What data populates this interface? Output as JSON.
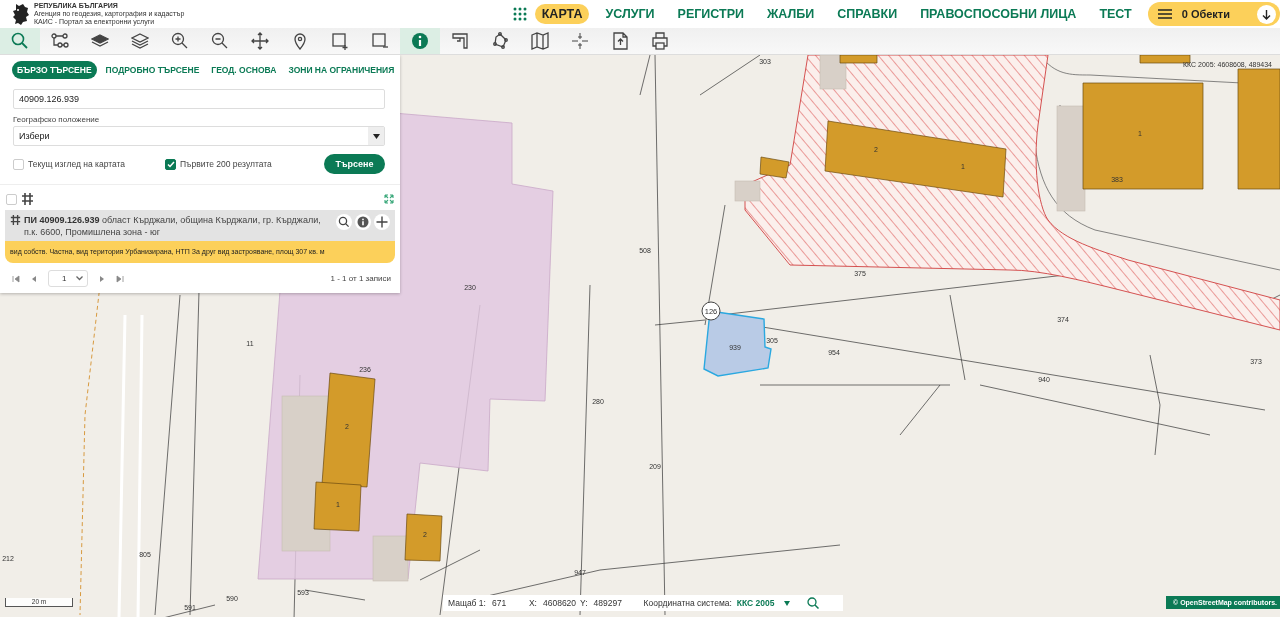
{
  "header": {
    "logo_lines": [
      "РЕПУБЛИКА БЪЛГАРИЯ",
      "Агенция по геодезия, картография и кадастър",
      "КАИС - Портал за електронни услуги"
    ],
    "nav": [
      {
        "label": "КАРТА",
        "selected": true
      },
      {
        "label": "УСЛУГИ",
        "selected": false
      },
      {
        "label": "РЕГИСТРИ",
        "selected": false
      },
      {
        "label": "ЖАЛБИ",
        "selected": false
      },
      {
        "label": "СПРАВКИ",
        "selected": false
      },
      {
        "label": "ПРАВОСПОСОБНИ ЛИЦА",
        "selected": false
      },
      {
        "label": "ТЕСТ",
        "selected": false
      }
    ],
    "cart": "0 Обекти"
  },
  "toolbar": [
    {
      "kind": "search",
      "selected": true
    },
    {
      "kind": "nodes",
      "selected": false
    },
    {
      "kind": "layer",
      "selected": false
    },
    {
      "kind": "layers",
      "selected": false
    },
    {
      "kind": "zoom-in",
      "selected": false
    },
    {
      "kind": "zoom-out",
      "selected": false
    },
    {
      "kind": "pan",
      "selected": false
    },
    {
      "kind": "pin",
      "selected": false
    },
    {
      "kind": "rect-plus",
      "selected": false
    },
    {
      "kind": "rect-minus",
      "selected": false
    },
    {
      "kind": "info",
      "selected": true
    },
    {
      "kind": "corner",
      "selected": false
    },
    {
      "kind": "polygon",
      "selected": false
    },
    {
      "kind": "map",
      "selected": false
    },
    {
      "kind": "crosshair",
      "selected": false
    },
    {
      "kind": "doc",
      "selected": false
    },
    {
      "kind": "print",
      "selected": false
    }
  ],
  "search_panel": {
    "tabs": [
      {
        "label": "БЪРЗО ТЪРСЕНЕ",
        "selected": true
      },
      {
        "label": "ПОДРОБНО ТЪРСЕНЕ",
        "selected": false
      },
      {
        "label": "ГЕОД. ОСНОВА",
        "selected": false
      },
      {
        "label": "ЗОНИ НА ОГРАНИЧЕНИЯ",
        "selected": false
      }
    ],
    "query": "40909.126.939",
    "location_label": "Географско положение",
    "location_value": "Избери",
    "options": [
      {
        "label": "Текущ изглед на картата",
        "checked": false
      },
      {
        "label": "Първите 200 резултата",
        "checked": true
      }
    ],
    "search_button": "Търсене",
    "select_all_checked": false,
    "result": {
      "title": "**ПИ 40909.126.939** област Кърджали, община Кърджали, гр. Кърджали, п.к. 6600, Промишлена зона - юг",
      "details": "вид собств. Частна, вид територия Урбанизирана, НТП За друг вид застрояване, площ 307 кв. м"
    },
    "pager": {
      "page": "1",
      "summary": "1 - 1 от 1 записи"
    }
  },
  "map": {
    "coords_label": "ККС 2005: 4608608, 489434",
    "marker": "126",
    "parcel_labels": [
      "303",
      "230",
      "375",
      "374",
      "373",
      "939",
      "954",
      "940",
      "280",
      "209",
      "508",
      "383",
      "1",
      "2",
      "1",
      "2",
      "1",
      "2",
      "11",
      "805",
      "212",
      "590",
      "593",
      "591",
      "947",
      "236",
      "305"
    ],
    "scale": "20 m",
    "attribution": "© OpenStreetMap contributors."
  },
  "status_bar": {
    "scale_label": "Мащаб 1:",
    "scale_value": "671",
    "x_label": "X:",
    "x_value": "4608620",
    "y_label": "Y:",
    "y_value": "489297",
    "crs_label": "Координатна система:",
    "crs_value": "ККС 2005"
  }
}
